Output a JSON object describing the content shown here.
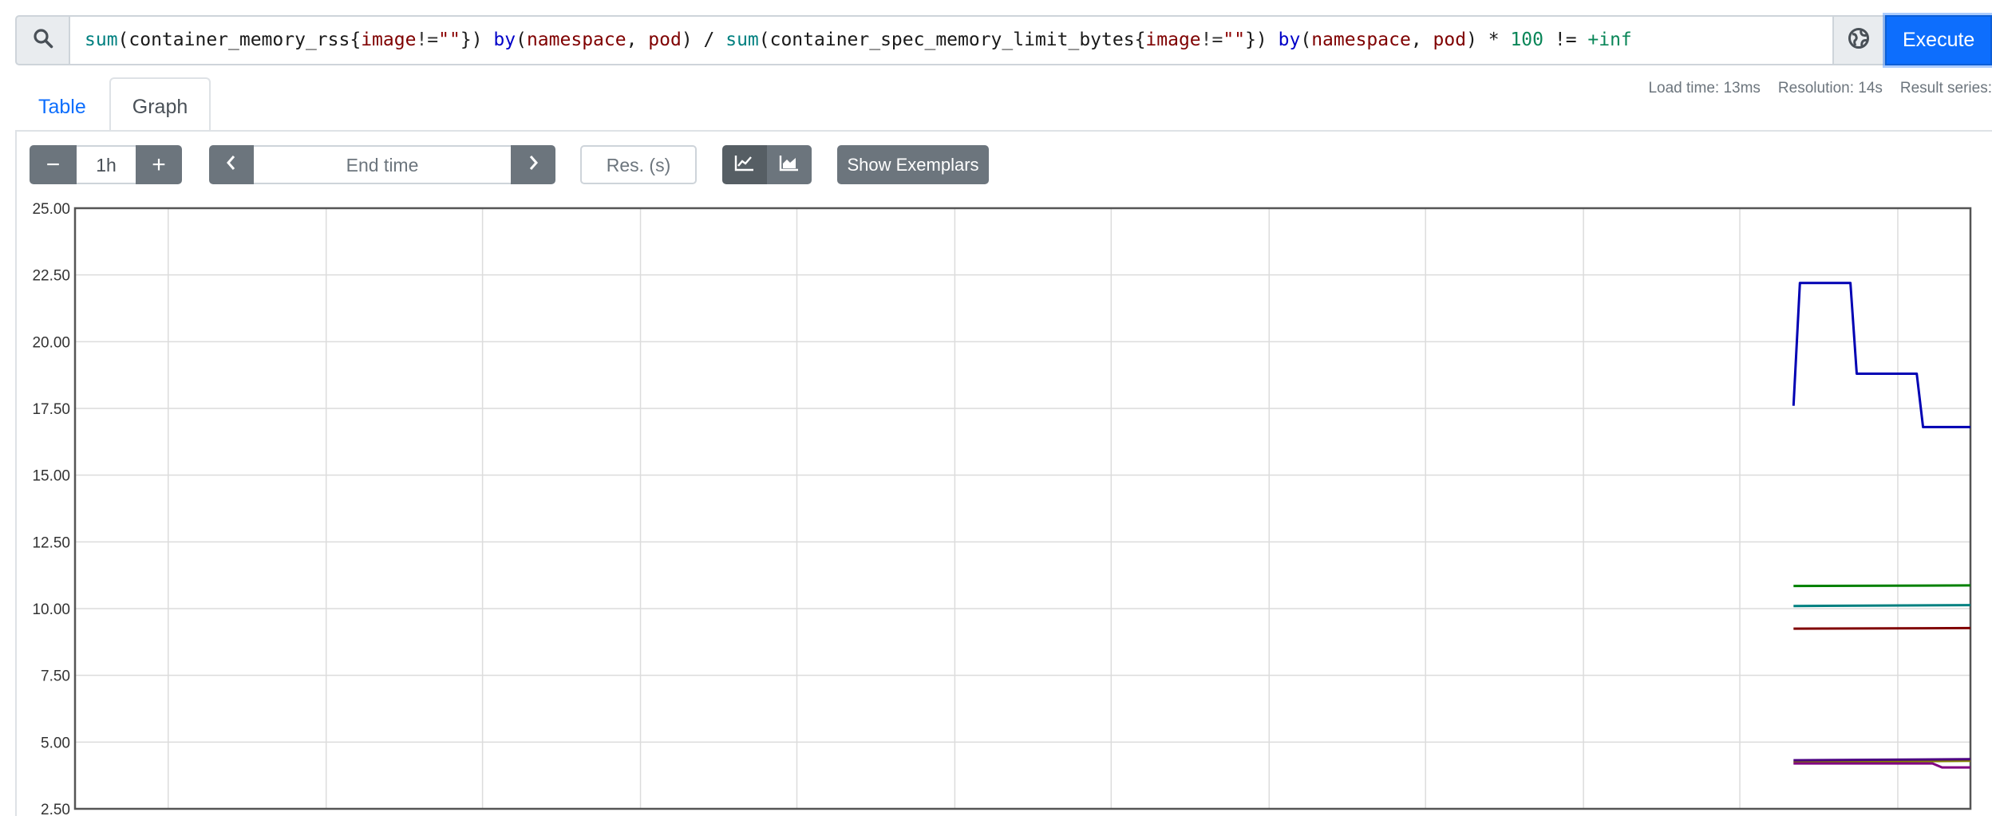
{
  "query": {
    "tokens": [
      {
        "t": "sum",
        "c": "fn"
      },
      {
        "t": "(container_memory_rss{",
        "c": "plain"
      },
      {
        "t": "image",
        "c": "label"
      },
      {
        "t": "!=",
        "c": "op"
      },
      {
        "t": "\"\"",
        "c": "str"
      },
      {
        "t": "}) ",
        "c": "plain"
      },
      {
        "t": "by",
        "c": "kw"
      },
      {
        "t": "(",
        "c": "plain"
      },
      {
        "t": "namespace",
        "c": "label"
      },
      {
        "t": ", ",
        "c": "plain"
      },
      {
        "t": "pod",
        "c": "label"
      },
      {
        "t": ") / ",
        "c": "plain"
      },
      {
        "t": "sum",
        "c": "fn"
      },
      {
        "t": "(container_spec_memory_limit_bytes{",
        "c": "plain"
      },
      {
        "t": "image",
        "c": "label"
      },
      {
        "t": "!=",
        "c": "op"
      },
      {
        "t": "\"\"",
        "c": "str"
      },
      {
        "t": "}) ",
        "c": "plain"
      },
      {
        "t": "by",
        "c": "kw"
      },
      {
        "t": "(",
        "c": "plain"
      },
      {
        "t": "namespace",
        "c": "label"
      },
      {
        "t": ", ",
        "c": "plain"
      },
      {
        "t": "pod",
        "c": "label"
      },
      {
        "t": ") * ",
        "c": "plain"
      },
      {
        "t": "100",
        "c": "num"
      },
      {
        "t": " != ",
        "c": "plain"
      },
      {
        "t": "+inf",
        "c": "num"
      }
    ]
  },
  "execute_label": "Execute",
  "tabs": [
    {
      "label": "Table",
      "active": false
    },
    {
      "label": "Graph",
      "active": true
    }
  ],
  "meta": {
    "load_time": "Load time: 13ms",
    "resolution": "Resolution: 14s",
    "result_series": "Result series:"
  },
  "controls": {
    "decrease": "−",
    "range": "1h",
    "increase": "+",
    "prev": "‹",
    "end_time_placeholder": "End time",
    "next": "›",
    "res_placeholder": "Res. (s)",
    "show_exemplars": "Show Exemplars"
  },
  "icons": {
    "search": "search-icon",
    "metrics_explorer": "globe-icon",
    "line_mode": "line-chart-icon",
    "stacked_mode": "area-chart-icon"
  },
  "chart_data": {
    "type": "line",
    "ylim": [
      2.5,
      25
    ],
    "yticks": [
      "25.00",
      "22.50",
      "20.00",
      "17.50",
      "15.00",
      "12.50",
      "10.00",
      "7.50",
      "5.00",
      "2.50"
    ],
    "x_range_minutes": [
      0,
      60
    ],
    "x_gridlines_minutes": [
      2.95,
      7.95,
      12.9,
      17.9,
      22.85,
      27.85,
      32.8,
      37.8,
      42.75,
      47.75,
      52.7,
      57.7
    ],
    "grid": true,
    "series": [
      {
        "color": "#0000b3",
        "points": [
          [
            54.4,
            17.6
          ],
          [
            54.6,
            22.2
          ],
          [
            56.2,
            22.2
          ],
          [
            56.4,
            18.8
          ],
          [
            58.3,
            18.8
          ],
          [
            58.5,
            16.8
          ],
          [
            60,
            16.8
          ]
        ]
      },
      {
        "color": "#008000",
        "points": [
          [
            54.4,
            10.85
          ],
          [
            60,
            10.87
          ]
        ]
      },
      {
        "color": "#008080",
        "points": [
          [
            54.4,
            10.1
          ],
          [
            60,
            10.13
          ]
        ]
      },
      {
        "color": "#800000",
        "points": [
          [
            54.4,
            9.25
          ],
          [
            60,
            9.27
          ]
        ]
      },
      {
        "color": "#808000",
        "points": [
          [
            54.4,
            4.25
          ],
          [
            60,
            4.3
          ]
        ]
      },
      {
        "color": "#4b0082",
        "points": [
          [
            54.4,
            4.32
          ],
          [
            60,
            4.36
          ]
        ]
      },
      {
        "color": "#800080",
        "points": [
          [
            54.4,
            4.2
          ],
          [
            58.8,
            4.2
          ],
          [
            59.1,
            4.05
          ],
          [
            60,
            4.05
          ]
        ]
      }
    ]
  }
}
